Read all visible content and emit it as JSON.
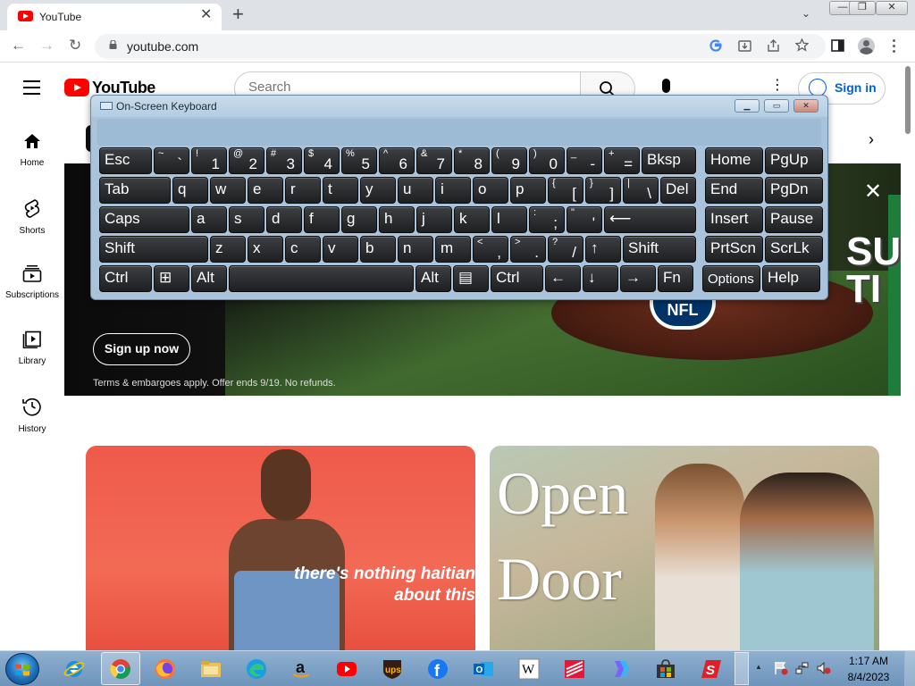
{
  "browser": {
    "tab_title": "YouTube",
    "tab_close": "✕",
    "new_tab": "+",
    "tab_search": "⌄",
    "window_buttons": {
      "minimize": "—",
      "restore": "❐",
      "close": "✕"
    },
    "url": "youtube.com",
    "nav": {
      "back": "←",
      "forward": "→",
      "reload": "↻"
    },
    "omnibox_icons": [
      "google-icon",
      "install-icon",
      "share-icon",
      "bookmark-star-icon",
      "side-panel-icon",
      "profile-icon",
      "menu-dots-icon"
    ]
  },
  "youtube": {
    "logo_text": "YouTube",
    "search_placeholder": "Search",
    "sign_in": "Sign in",
    "sidebar": [
      {
        "label": "Home",
        "icon": "home-icon"
      },
      {
        "label": "Shorts",
        "icon": "shorts-icon"
      },
      {
        "label": "Subscriptions",
        "icon": "subscriptions-icon"
      },
      {
        "label": "Library",
        "icon": "library-icon"
      },
      {
        "label": "History",
        "icon": "history-icon"
      }
    ],
    "banner": {
      "cta": "Sign up now",
      "terms": "Terms & embargoes apply. Offer ends 9/19. No refunds.",
      "brand_mark": "NFL",
      "partial_headline": "SU\nTI"
    },
    "videos": [
      {
        "overlay_text": "there's nothing haitian about this"
      },
      {
        "overlay_text": "Open Door"
      }
    ]
  },
  "osk": {
    "title": "On-Screen Keyboard",
    "rows": [
      [
        {
          "main": "Esc",
          "w": 59
        },
        {
          "sh": "~",
          "lo": "`",
          "w": 40
        },
        {
          "sh": "!",
          "lo": "1",
          "w": 40
        },
        {
          "sh": "@",
          "lo": "2",
          "w": 40
        },
        {
          "sh": "#",
          "lo": "3",
          "w": 40
        },
        {
          "sh": "$",
          "lo": "4",
          "w": 40
        },
        {
          "sh": "%",
          "lo": "5",
          "w": 40
        },
        {
          "sh": "^",
          "lo": "6",
          "w": 40
        },
        {
          "sh": "&",
          "lo": "7",
          "w": 40
        },
        {
          "sh": "*",
          "lo": "8",
          "w": 40
        },
        {
          "sh": "(",
          "lo": "9",
          "w": 40
        },
        {
          "sh": ")",
          "lo": "0",
          "w": 40
        },
        {
          "sh": "_",
          "lo": "-",
          "w": 40
        },
        {
          "sh": "+",
          "lo": "=",
          "w": 40
        },
        {
          "main": "Bksp",
          "w": 61
        },
        {
          "main": "Home",
          "w": 65,
          "gap": 8
        },
        {
          "main": "PgUp",
          "w": 65
        }
      ],
      [
        {
          "main": "Tab",
          "w": 80
        },
        {
          "main": "q",
          "w": 40
        },
        {
          "main": "w",
          "w": 40
        },
        {
          "main": "e",
          "w": 40
        },
        {
          "main": "r",
          "w": 40
        },
        {
          "main": "t",
          "w": 40
        },
        {
          "main": "y",
          "w": 40
        },
        {
          "main": "u",
          "w": 40
        },
        {
          "main": "i",
          "w": 40
        },
        {
          "main": "o",
          "w": 40
        },
        {
          "main": "p",
          "w": 40
        },
        {
          "sh": "{",
          "lo": "[",
          "w": 40
        },
        {
          "sh": "}",
          "lo": "]",
          "w": 40
        },
        {
          "sh": "|",
          "lo": "\\",
          "w": 40
        },
        {
          "main": "Del",
          "w": 40
        },
        {
          "main": "End",
          "w": 65,
          "gap": 8
        },
        {
          "main": "PgDn",
          "w": 65
        }
      ],
      [
        {
          "main": "Caps",
          "w": 101
        },
        {
          "main": "a",
          "w": 40
        },
        {
          "main": "s",
          "w": 40
        },
        {
          "main": "d",
          "w": 40
        },
        {
          "main": "f",
          "w": 40
        },
        {
          "main": "g",
          "w": 40
        },
        {
          "main": "h",
          "w": 40
        },
        {
          "main": "j",
          "w": 40
        },
        {
          "main": "k",
          "w": 40
        },
        {
          "main": "l",
          "w": 40
        },
        {
          "sh": ":",
          "lo": ";",
          "w": 40
        },
        {
          "sh": "\"",
          "lo": "'",
          "w": 40
        },
        {
          "main": "⟵",
          "w": 103
        },
        {
          "main": "Insert",
          "w": 65,
          "gap": 8
        },
        {
          "main": "Pause",
          "w": 65
        }
      ],
      [
        {
          "main": "Shift",
          "w": 122
        },
        {
          "main": "z",
          "w": 40
        },
        {
          "main": "x",
          "w": 40
        },
        {
          "main": "c",
          "w": 40
        },
        {
          "main": "v",
          "w": 40
        },
        {
          "main": "b",
          "w": 40
        },
        {
          "main": "n",
          "w": 40
        },
        {
          "main": "m",
          "w": 40
        },
        {
          "sh": "<",
          "lo": ",",
          "w": 40
        },
        {
          "sh": ">",
          "lo": ".",
          "w": 40
        },
        {
          "sh": "?",
          "lo": "/",
          "w": 40
        },
        {
          "main": "↑",
          "w": 40
        },
        {
          "main": "Shift",
          "w": 82
        },
        {
          "main": "PrtScn",
          "w": 65,
          "gap": 8
        },
        {
          "main": "ScrLk",
          "w": 65
        }
      ],
      [
        {
          "main": "Ctrl",
          "w": 59
        },
        {
          "main": "⊞",
          "w": 40
        },
        {
          "main": "Alt",
          "w": 40
        },
        {
          "main": "",
          "w": 207
        },
        {
          "main": "Alt",
          "w": 40
        },
        {
          "main": "▤",
          "w": 40
        },
        {
          "main": "Ctrl",
          "w": 59
        },
        {
          "main": "←",
          "w": 40
        },
        {
          "main": "↓",
          "w": 40
        },
        {
          "main": "→",
          "w": 40
        },
        {
          "main": "Fn",
          "w": 40
        },
        {
          "main": "Options",
          "w": 65,
          "gap": 8,
          "small": true
        },
        {
          "main": "Help",
          "w": 65
        }
      ]
    ]
  },
  "taskbar": {
    "apps": [
      "start-orb",
      "internet-explorer-icon",
      "chrome-icon",
      "firefox-icon",
      "file-explorer-icon",
      "edge-icon",
      "amazon-icon",
      "youtube-icon",
      "ups-icon",
      "facebook-icon",
      "outlook-icon",
      "wikipedia-icon",
      "bank-of-america-icon",
      "copilot-icon",
      "store-icon",
      "speedway-icon"
    ],
    "amazon_glyph": "a",
    "ups_label": "ups",
    "facebook_glyph": "f",
    "outlook_glyph": "O",
    "wikipedia_glyph": "W",
    "speedway_glyph": "S",
    "time": "1:17 AM",
    "date": "8/4/2023",
    "tray_up": "▲"
  }
}
